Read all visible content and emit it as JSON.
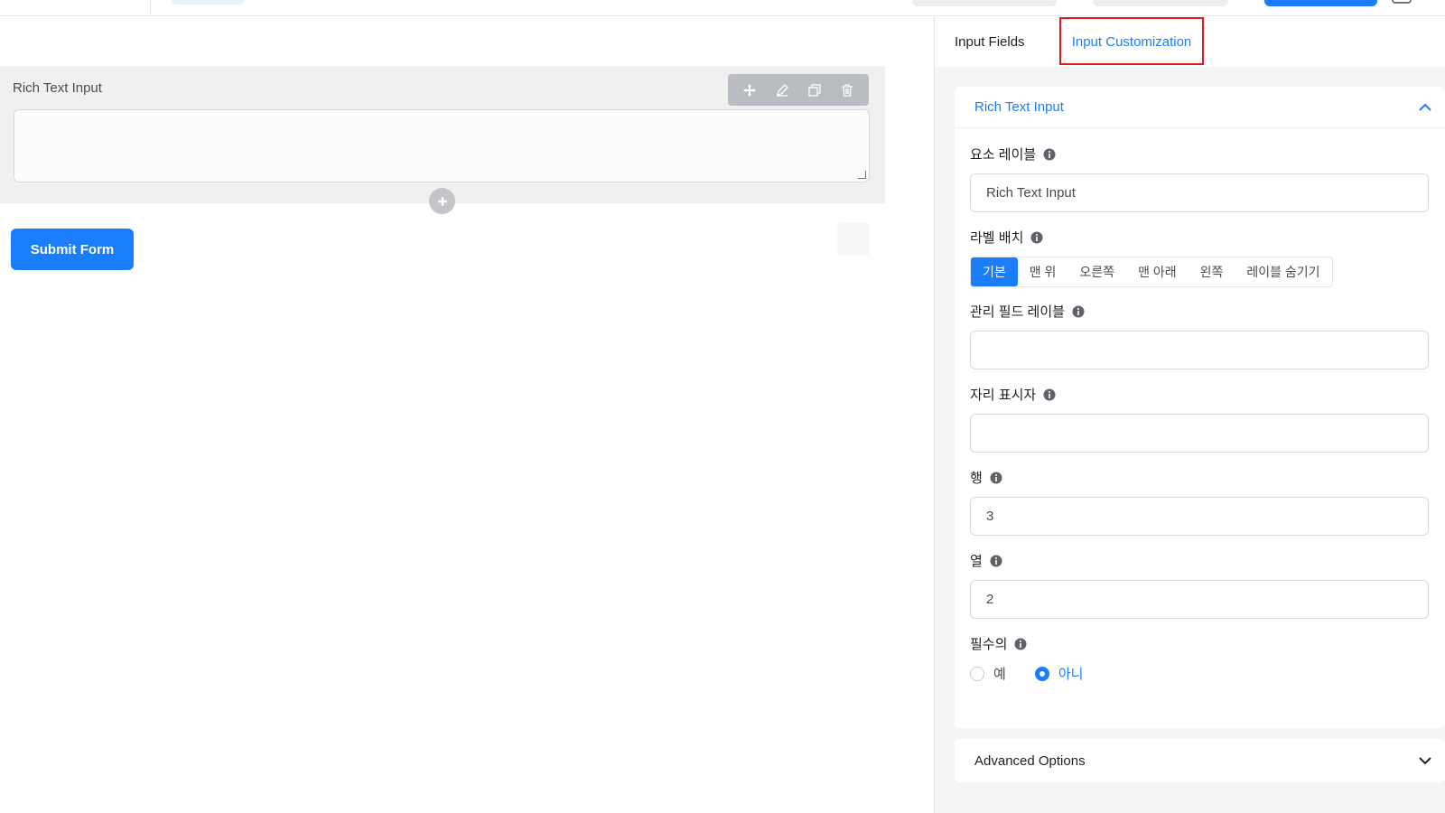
{
  "canvas": {
    "field_label": "Rich Text Input",
    "submit_label": "Submit Form"
  },
  "panel": {
    "tabs": [
      {
        "label": "Input Fields",
        "active": false
      },
      {
        "label": "Input Customization",
        "active": true
      }
    ],
    "section": {
      "title": "Rich Text Input",
      "element_label": {
        "label": "요소 레이블",
        "value": "Rich Text Input"
      },
      "label_placement": {
        "label": "라벨 배치",
        "options": [
          "기본",
          "맨 위",
          "오른쪽",
          "맨 아래",
          "왼쪽",
          "레이블 숨기기"
        ],
        "selected": "기본"
      },
      "admin_label": {
        "label": "관리 필드 레이블",
        "value": ""
      },
      "placeholder": {
        "label": "자리 표시자",
        "value": ""
      },
      "rows": {
        "label": "행",
        "value": "3"
      },
      "cols": {
        "label": "열",
        "value": "2"
      },
      "required": {
        "label": "필수의",
        "yes": "예",
        "no": "아니",
        "selected": "no"
      }
    },
    "advanced": {
      "title": "Advanced Options"
    }
  },
  "colors": {
    "accent": "#1a7efb",
    "highlight": "#e31a1c",
    "panel_bg": "#f4f5f7"
  }
}
